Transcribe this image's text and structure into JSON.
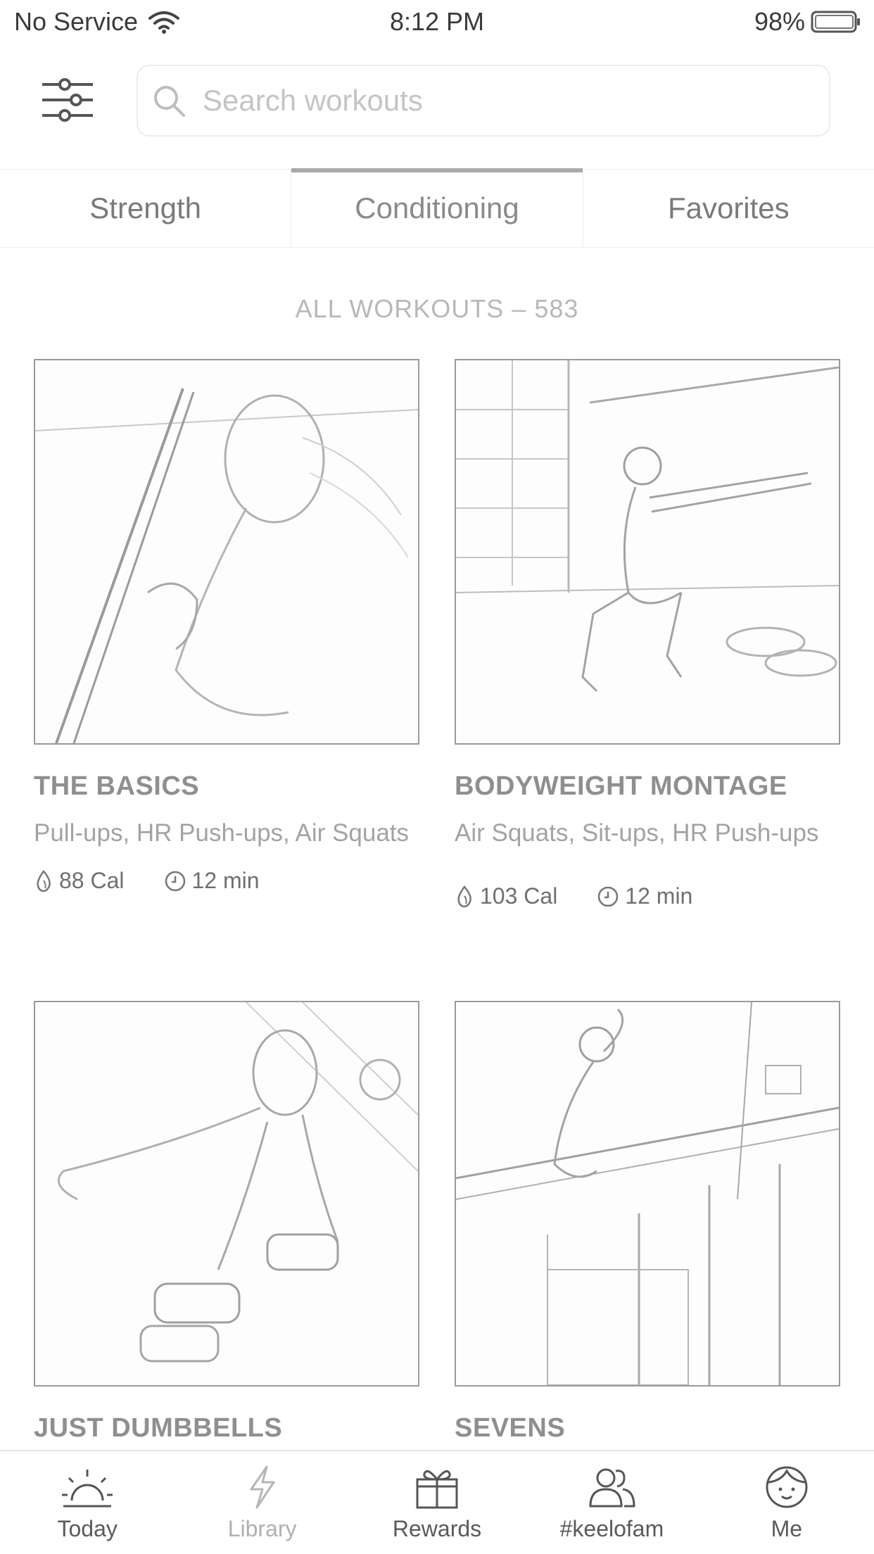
{
  "status_bar": {
    "carrier": "No Service",
    "time": "8:12 PM",
    "battery": "98%"
  },
  "search": {
    "placeholder": "Search workouts",
    "value": ""
  },
  "tabs": [
    {
      "label": "Strength",
      "active": false
    },
    {
      "label": "Conditioning",
      "active": true
    },
    {
      "label": "Favorites",
      "active": false
    }
  ],
  "section": {
    "heading": "ALL WORKOUTS – 583"
  },
  "workouts": [
    {
      "title": "THE BASICS",
      "exercises": "Pull-ups, HR Push-ups, Air Squats",
      "calories": "88 Cal",
      "duration": "12 min"
    },
    {
      "title": "BODYWEIGHT MONTAGE",
      "exercises": "Air Squats, Sit-ups, HR Push-ups",
      "calories": "103 Cal",
      "duration": "12 min"
    },
    {
      "title": "JUST DUMBBELLS"
    },
    {
      "title": "SEVENS"
    }
  ],
  "tabbar": [
    {
      "label": "Today",
      "icon": "sun-icon"
    },
    {
      "label": "Library",
      "icon": "lightning-icon"
    },
    {
      "label": "Rewards",
      "icon": "gift-icon"
    },
    {
      "label": "#keelofam",
      "icon": "people-icon"
    },
    {
      "label": "Me",
      "icon": "face-icon"
    }
  ]
}
